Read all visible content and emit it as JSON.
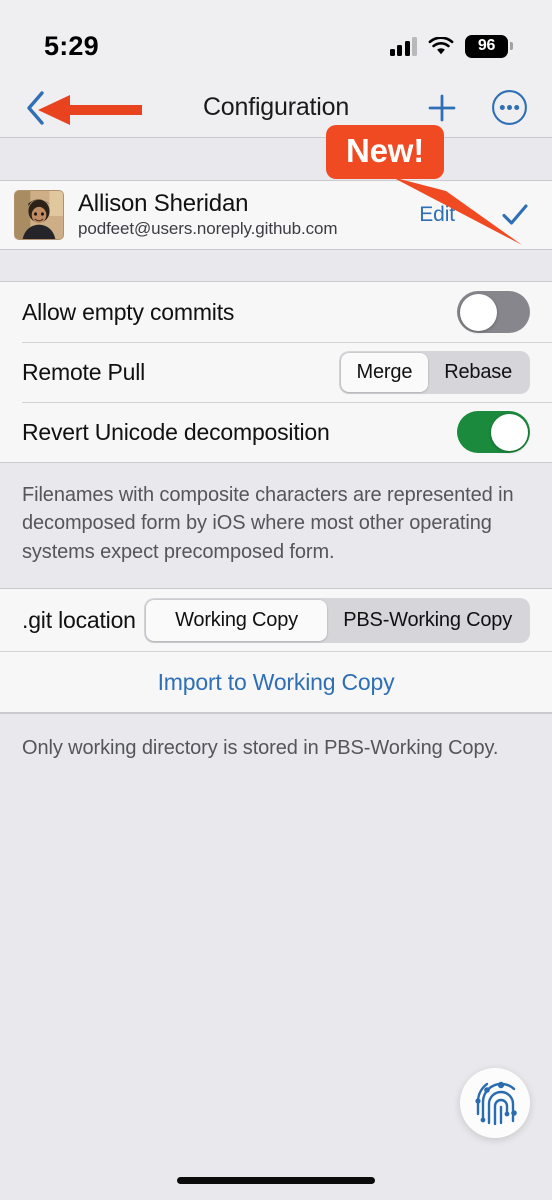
{
  "status_bar": {
    "time": "5:29",
    "battery_level": "96",
    "signal_icon": "cellular-bars-icon",
    "wifi_icon": "wifi-icon",
    "battery_icon": "battery-icon"
  },
  "nav_bar": {
    "title": "Configuration",
    "back_icon": "chevron-left-icon",
    "add_icon": "plus-icon",
    "more_icon": "more-circle-icon"
  },
  "annotations": {
    "new_badge": "New!",
    "new_badge_color": "#F04A23",
    "arrow_color": "#E8421F"
  },
  "account": {
    "name": "Allison Sheridan",
    "email": "podfeet@users.noreply.github.com",
    "edit_label": "Edit",
    "avatar_name": "user-avatar",
    "selected_icon": "checkmark-icon"
  },
  "settings": {
    "rows": [
      {
        "label": "Allow empty commits",
        "control": "toggle",
        "state": "off"
      },
      {
        "label": "Remote Pull",
        "control": "segmented",
        "options": [
          "Merge",
          "Rebase"
        ],
        "selected": "Merge"
      },
      {
        "label": "Revert Unicode decomposition",
        "control": "toggle",
        "state": "on"
      }
    ],
    "footer_note": "Filenames with composite characters are represented in decomposed form by iOS where most other operating systems expect precomposed form."
  },
  "git_location": {
    "label": ".git location",
    "options": [
      "Working Copy",
      "PBS-Working Copy"
    ],
    "selected": "Working Copy",
    "import_label": "Import to Working Copy",
    "footer_note": "Only working directory is stored in PBS-Working Copy."
  },
  "fab": {
    "icon": "fingerprint-icon"
  },
  "colors": {
    "accent_blue": "#2F6FB5",
    "toggle_on_green": "#1B8A3C",
    "toggle_off_gray": "#86868C",
    "group_background": "#E8E8ED",
    "row_background": "#F7F7F7"
  }
}
